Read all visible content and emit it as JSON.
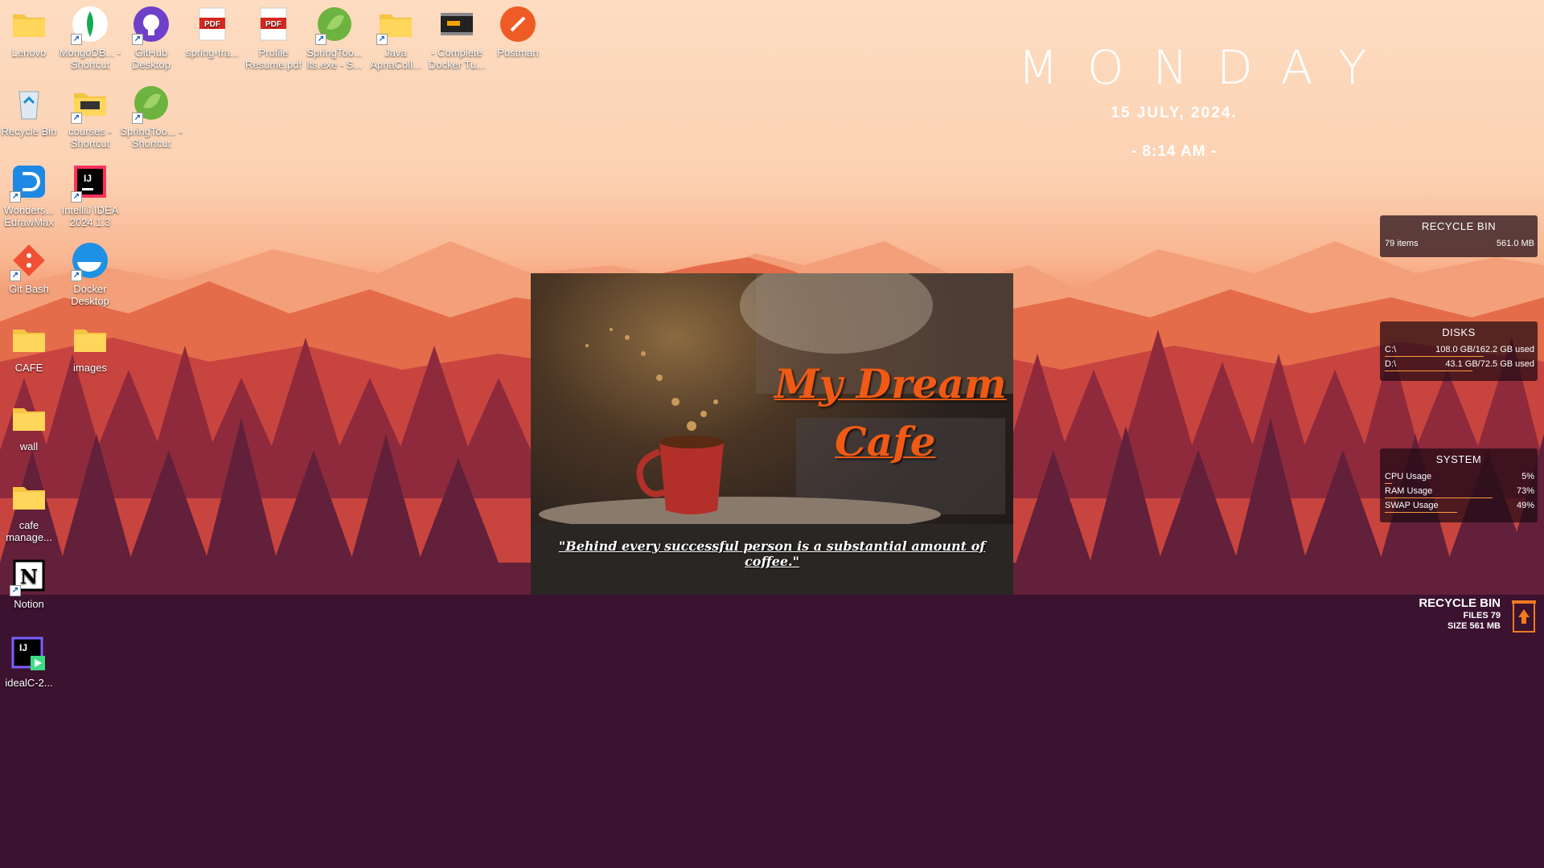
{
  "desktop_icons": [
    {
      "label": "Lenovo",
      "icon": "folder-icon"
    },
    {
      "label": "MongoDB... - Shortcut",
      "icon": "mongodb-icon"
    },
    {
      "label": "GitHub Desktop",
      "icon": "github-icon"
    },
    {
      "label": "spring-fra...",
      "icon": "pdf-icon"
    },
    {
      "label": "Profile Resume.pdf",
      "icon": "pdf-icon"
    },
    {
      "label": "SpringToo... lts.exe - S...",
      "icon": "spring-icon"
    },
    {
      "label": "Java ApnaColl...",
      "icon": "folder-icon"
    },
    {
      "label": "- Complete Docker Tu...",
      "icon": "video-icon"
    },
    {
      "label": "Postman",
      "icon": "postman-icon"
    },
    {
      "label": "Recycle Bin",
      "icon": "recycle-bin-icon"
    },
    {
      "label": "courses - Shortcut",
      "icon": "folder-shortcut-icon"
    },
    {
      "label": "SpringToo... - Shortcut",
      "icon": "spring-icon"
    },
    {
      "label": "Wonders... EdrawMax",
      "icon": "edrawmax-icon"
    },
    {
      "label": "IntelliJ IDEA 2024.1.3",
      "icon": "intellij-icon"
    },
    {
      "label": "Git Bash",
      "icon": "git-icon"
    },
    {
      "label": "Docker Desktop",
      "icon": "docker-icon"
    },
    {
      "label": "CAFE",
      "icon": "folder-icon"
    },
    {
      "label": "images",
      "icon": "folder-icon"
    },
    {
      "label": "wall",
      "icon": "folder-icon"
    },
    {
      "label": "cafe manage...",
      "icon": "folder-icon"
    },
    {
      "label": "Notion",
      "icon": "notion-icon"
    },
    {
      "label": "idealC-2...",
      "icon": "intellij-installer-icon"
    }
  ],
  "day_widget": {
    "day": "MONDAY",
    "date": "15 JULY, 2024.",
    "time": "- 8:14 AM -"
  },
  "recycle_panel": {
    "title": "RECYCLE BIN",
    "items": "79 items",
    "size": "561.0 MB"
  },
  "disks_panel": {
    "title": "DISKS",
    "rows": [
      {
        "label": "C:\\",
        "value": "108.0 GB/162.2 GB used",
        "fraction": 0.666
      },
      {
        "label": "D:\\",
        "value": "43.1 GB/72.5 GB used",
        "fraction": 0.594
      }
    ]
  },
  "system_panel": {
    "title": "SYSTEM",
    "rows": [
      {
        "label": "CPU Usage",
        "value": "5%",
        "fraction": 0.05
      },
      {
        "label": "RAM Usage",
        "value": "73%",
        "fraction": 0.73
      },
      {
        "label": "SWAP Usage",
        "value": "49%",
        "fraction": 0.49
      }
    ]
  },
  "cafe_card": {
    "title_line1": "My Dream",
    "title_line2": "Cafe",
    "quote": "\"Behind every successful person is a substantial amount of coffee.\""
  },
  "recycle_corner": {
    "title": "RECYCLE BIN",
    "files": "FILES 79",
    "size": "SIZE 561 MB"
  },
  "colors": {
    "accent_orange": "#f05a14",
    "bar_orange": "#ff9a40"
  }
}
